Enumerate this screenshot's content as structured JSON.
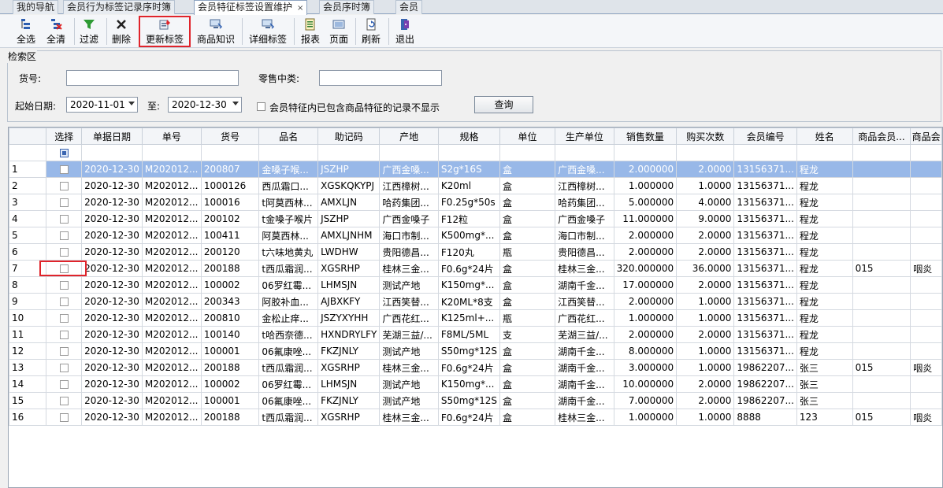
{
  "tabs": [
    {
      "label": "我的导航"
    },
    {
      "label": "会员行为标签记录序时簿"
    },
    {
      "label": "会员特征标签设置维护",
      "active": true,
      "close": "×"
    },
    {
      "label": "会员序时簿"
    },
    {
      "label": "会员"
    }
  ],
  "toolbar": {
    "select_all": "全选",
    "clear_all": "全清",
    "filter": "过滤",
    "delete": "删除",
    "update_tag": "更新标签",
    "product_knowledge": "商品知识",
    "detail_tag": "详细标签",
    "report": "报表",
    "page": "页面",
    "refresh": "刷新",
    "exit": "退出"
  },
  "search": {
    "legend": "检索区",
    "goods_no_label": "货号:",
    "goods_no_value": "",
    "retail_category_label": "零售中类:",
    "retail_category_value": "",
    "start_date_label": "起始日期:",
    "start_date_value": "2020-11-01",
    "to_label": "至:",
    "end_date_value": "2020-12-30",
    "exclude_label": "会员特征内已包含商品特征的记录不显示",
    "query_button": "查询"
  },
  "grid": {
    "columns": [
      "",
      "选择",
      "单据日期",
      "单号",
      "货号",
      "品名",
      "助记码",
      "产地",
      "规格",
      "单位",
      "生产单位",
      "销售数量",
      "购买次数",
      "会员编号",
      "姓名",
      "商品会员...",
      "商品会"
    ],
    "rows": [
      [
        "1",
        "",
        "2020-12-30",
        "M202012...",
        "200807",
        "金嗓子喉...",
        "JSZHP",
        "广西金嗓...",
        "S2g*16S",
        "盒",
        "广西金嗓...",
        "2.000000",
        "2.0000",
        "13156371...",
        "程龙",
        "",
        ""
      ],
      [
        "2",
        "",
        "2020-12-30",
        "M202012...",
        "1000126",
        "西瓜霜口...",
        "XGSKQKYPJ",
        "江西樟树...",
        "K20ml",
        "盒",
        "江西樟树...",
        "1.000000",
        "1.0000",
        "13156371...",
        "程龙",
        "",
        ""
      ],
      [
        "3",
        "",
        "2020-12-30",
        "M202012...",
        "100016",
        "t阿莫西林...",
        "AMXLJN",
        "哈药集团...",
        "F0.25g*50s",
        "盒",
        "哈药集团...",
        "5.000000",
        "4.0000",
        "13156371...",
        "程龙",
        "",
        ""
      ],
      [
        "4",
        "",
        "2020-12-30",
        "M202012...",
        "200102",
        "t金嗓子喉片",
        "JSZHP",
        "广西金嗓子",
        "F12粒",
        "盒",
        "广西金嗓子",
        "11.000000",
        "9.0000",
        "13156371...",
        "程龙",
        "",
        ""
      ],
      [
        "5",
        "",
        "2020-12-30",
        "M202012...",
        "100411",
        "阿莫西林...",
        "AMXLJNHM",
        "海口市制...",
        "K500mg*...",
        "盒",
        "海口市制...",
        "2.000000",
        "2.0000",
        "13156371...",
        "程龙",
        "",
        ""
      ],
      [
        "6",
        "",
        "2020-12-30",
        "M202012...",
        "200120",
        "t六味地黄丸",
        "LWDHW",
        "贵阳德昌...",
        "F120丸",
        "瓶",
        "贵阳德昌...",
        "2.000000",
        "2.0000",
        "13156371...",
        "程龙",
        "",
        ""
      ],
      [
        "7",
        "",
        "2020-12-30",
        "M202012...",
        "200188",
        "t西瓜霜润...",
        "XGSRHP",
        "桂林三金...",
        "F0.6g*24片",
        "盒",
        "桂林三金...",
        "320.000000",
        "36.0000",
        "13156371...",
        "程龙",
        "015",
        "咽炎"
      ],
      [
        "8",
        "",
        "2020-12-30",
        "M202012...",
        "100002",
        "06罗红霉...",
        "LHMSJN",
        "测试产地",
        "K150mg*...",
        "盒",
        "湖南千金...",
        "17.000000",
        "2.0000",
        "13156371...",
        "程龙",
        "",
        ""
      ],
      [
        "9",
        "",
        "2020-12-30",
        "M202012...",
        "200343",
        "阿胶补血...",
        "AJBXKFY",
        "江西笑替...",
        "K20ML*8支",
        "盒",
        "江西笑替...",
        "2.000000",
        "1.0000",
        "13156371...",
        "程龙",
        "",
        ""
      ],
      [
        "10",
        "",
        "2020-12-30",
        "M202012...",
        "200810",
        "金松止痒...",
        "JSZYXYHH",
        "广西花红...",
        "K125ml+...",
        "瓶",
        "广西花红...",
        "1.000000",
        "1.0000",
        "13156371...",
        "程龙",
        "",
        ""
      ],
      [
        "11",
        "",
        "2020-12-30",
        "M202012...",
        "100140",
        "t哈西奈德...",
        "HXNDRYLFY",
        "芜湖三益/...",
        "F8ML/5ML",
        "支",
        "芜湖三益/...",
        "2.000000",
        "2.0000",
        "13156371...",
        "程龙",
        "",
        ""
      ],
      [
        "12",
        "",
        "2020-12-30",
        "M202012...",
        "100001",
        "06氟康唑...",
        "FKZJNLY",
        "测试产地",
        "S50mg*12S",
        "盒",
        "湖南千金...",
        "8.000000",
        "1.0000",
        "13156371...",
        "程龙",
        "",
        ""
      ],
      [
        "13",
        "",
        "2020-12-30",
        "M202012...",
        "200188",
        "t西瓜霜润...",
        "XGSRHP",
        "桂林三金...",
        "F0.6g*24片",
        "盒",
        "湖南千金...",
        "3.000000",
        "1.0000",
        "19862207...",
        "张三",
        "015",
        "咽炎"
      ],
      [
        "14",
        "",
        "2020-12-30",
        "M202012...",
        "100002",
        "06罗红霉...",
        "LHMSJN",
        "测试产地",
        "K150mg*...",
        "盒",
        "湖南千金...",
        "10.000000",
        "2.0000",
        "19862207...",
        "张三",
        "",
        ""
      ],
      [
        "15",
        "",
        "2020-12-30",
        "M202012...",
        "100001",
        "06氟康唑...",
        "FKZJNLY",
        "测试产地",
        "S50mg*12S",
        "盒",
        "湖南千金...",
        "7.000000",
        "2.0000",
        "19862207...",
        "张三",
        "",
        ""
      ],
      [
        "16",
        "",
        "2020-12-30",
        "M202012...",
        "200188",
        "t西瓜霜润...",
        "XGSRHP",
        "桂林三金...",
        "F0.6g*24片",
        "盒",
        "桂林三金...",
        "1.000000",
        "1.0000",
        "8888",
        "123",
        "015",
        "咽炎"
      ]
    ],
    "selected_row": 0
  },
  "colors": {
    "highlight": "#e0242b",
    "selected_row": "#98b8e8"
  }
}
